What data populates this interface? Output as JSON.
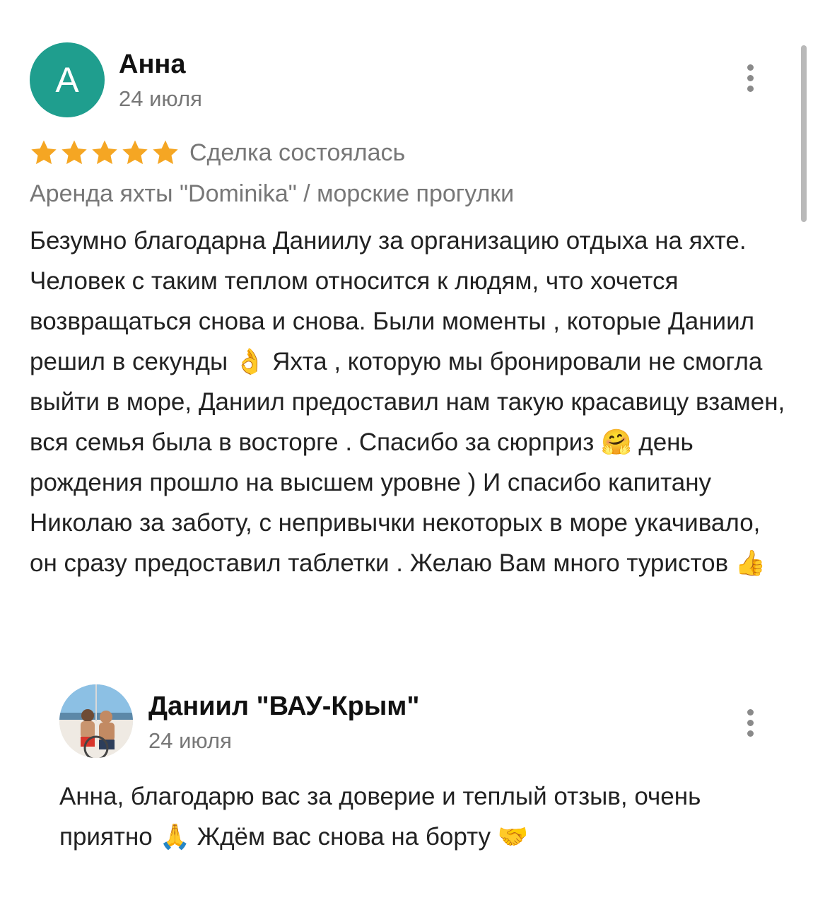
{
  "review": {
    "avatar_letter": "А",
    "avatar_color": "#1f9e8e",
    "author": "Анна",
    "date": "24 июля",
    "rating": 5,
    "rating_max": 5,
    "star_color": "#f5a623",
    "status": "Сделка состоялась",
    "service": "Аренда яхты \"Dominika\" / морские прогулки",
    "text": "Безумно благодарна Даниилу за организацию отдыха на яхте. Человек с таким теплом относится к людям, что хочется возвращаться снова и снова. Были моменты , которые Даниил решил в секунды 👌 Яхта , которую мы бронировали не смогла выйти в море, Даниил предоставил нам такую красавицу взамен, вся семья была в восторге . Спасибо за сюрприз 🤗 день рождения прошло на высшем уровне ) И спасибо капитану Николаю за заботу, с непривычки некоторых в море укачивало, он сразу предоставил таблетки . Желаю Вам много туристов 👍",
    "menu_icon": "more-vertical-icon"
  },
  "reply": {
    "author": "Даниил \"ВАУ-Крым\"",
    "date": "24 июля",
    "text": "Анна, благодарю вас за доверие и теплый отзыв, очень приятно 🙏 Ждём вас снова на борту 🤝",
    "avatar": "profile-photo",
    "menu_icon": "more-vertical-icon"
  }
}
